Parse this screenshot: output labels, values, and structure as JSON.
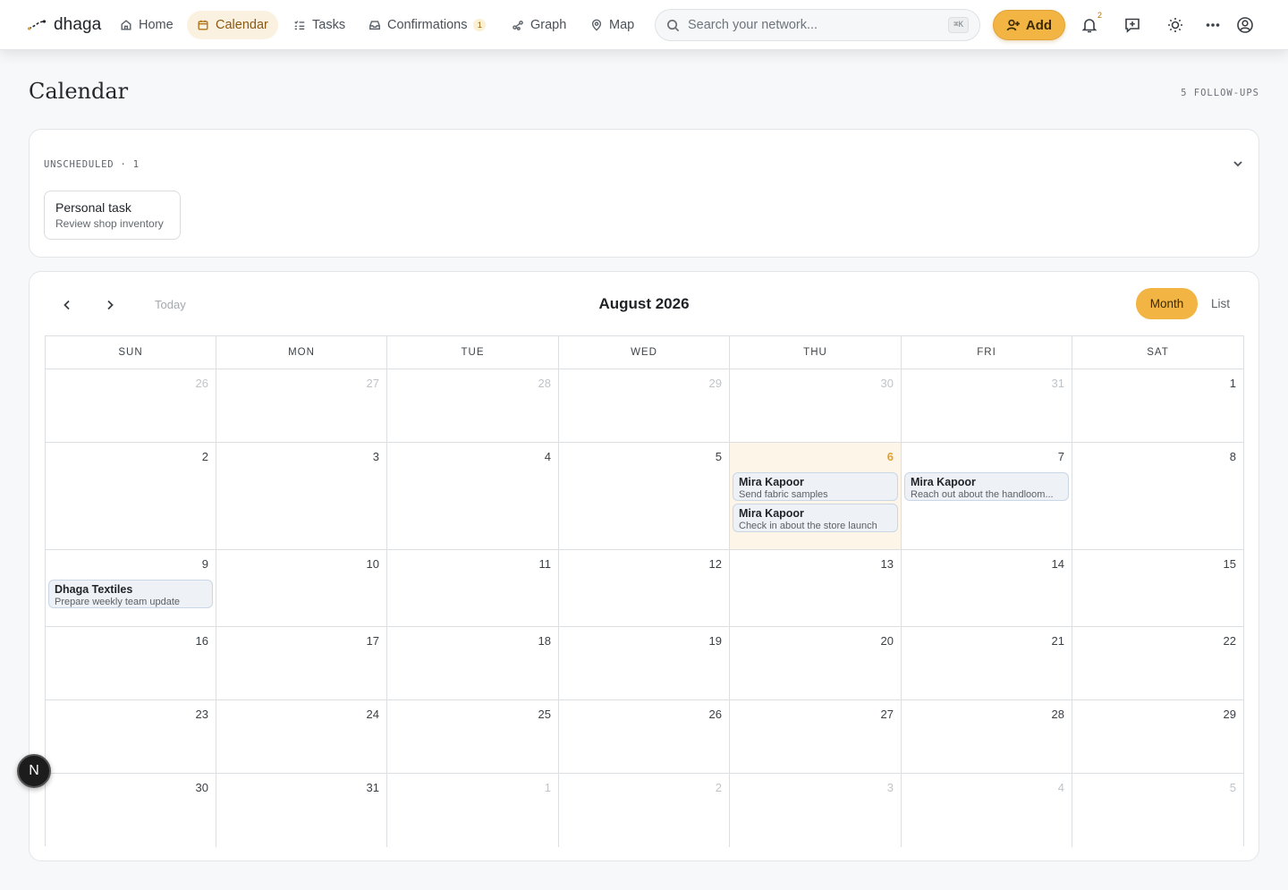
{
  "app": {
    "name": "dhaga"
  },
  "nav": {
    "items": [
      {
        "key": "home",
        "label": "Home",
        "icon": "home-icon"
      },
      {
        "key": "calendar",
        "label": "Calendar",
        "icon": "calendar-icon",
        "active": true
      },
      {
        "key": "tasks",
        "label": "Tasks",
        "icon": "tasks-icon"
      },
      {
        "key": "confirmations",
        "label": "Confirmations",
        "icon": "inbox-icon",
        "badge": "1"
      },
      {
        "key": "graph",
        "label": "Graph",
        "icon": "graph-icon"
      },
      {
        "key": "map",
        "label": "Map",
        "icon": "map-pin-icon"
      }
    ]
  },
  "search": {
    "placeholder": "Search your network...",
    "shortcut": "⌘K"
  },
  "toolbar": {
    "add_label": "Add",
    "notification_count": "2"
  },
  "page": {
    "title": "Calendar",
    "followups": "5 FOLLOW-UPS"
  },
  "unscheduled": {
    "label": "UNSCHEDULED · 1",
    "items": [
      {
        "title": "Personal task",
        "subtitle": "Review shop inventory"
      }
    ]
  },
  "calendar": {
    "today_label": "Today",
    "month_title": "August 2026",
    "views": {
      "month": "Month",
      "list": "List",
      "active": "month"
    },
    "weekdays": [
      "SUN",
      "MON",
      "TUE",
      "WED",
      "THU",
      "FRI",
      "SAT"
    ],
    "weeks": [
      [
        "26",
        "27",
        "28",
        "29",
        "30",
        "31",
        "1"
      ],
      [
        "2",
        "3",
        "4",
        "5",
        "6",
        "7",
        "8"
      ],
      [
        "9",
        "10",
        "11",
        "12",
        "13",
        "14",
        "15"
      ],
      [
        "16",
        "17",
        "18",
        "19",
        "20",
        "21",
        "22"
      ],
      [
        "23",
        "24",
        "25",
        "26",
        "27",
        "28",
        "29"
      ],
      [
        "30",
        "31",
        "1",
        "2",
        "3",
        "4",
        "5"
      ]
    ],
    "outside_month": [
      [
        true,
        true,
        true,
        true,
        true,
        true,
        false
      ],
      [
        false,
        false,
        false,
        false,
        false,
        false,
        false
      ],
      [
        false,
        false,
        false,
        false,
        false,
        false,
        false
      ],
      [
        false,
        false,
        false,
        false,
        false,
        false,
        false
      ],
      [
        false,
        false,
        false,
        false,
        false,
        false,
        false
      ],
      [
        false,
        false,
        true,
        true,
        true,
        true,
        true
      ]
    ],
    "today": {
      "week": 1,
      "day": 4
    },
    "events": [
      {
        "week": 1,
        "day": 4,
        "title": "Mira Kapoor",
        "subtitle": "Send fabric samples"
      },
      {
        "week": 1,
        "day": 4,
        "title": "Mira Kapoor",
        "subtitle": "Check in about the store launch"
      },
      {
        "week": 1,
        "day": 5,
        "title": "Mira Kapoor",
        "subtitle": "Reach out about the handloom..."
      },
      {
        "week": 2,
        "day": 0,
        "title": "Dhaga Textiles",
        "subtitle": "Prepare weekly team update"
      }
    ]
  },
  "floating": {
    "label": "N"
  },
  "colors": {
    "accent": "#f2b544",
    "today_bg": "#fdf6e8",
    "today_text": "#e0a030",
    "event_bg": "#eef2f6"
  }
}
